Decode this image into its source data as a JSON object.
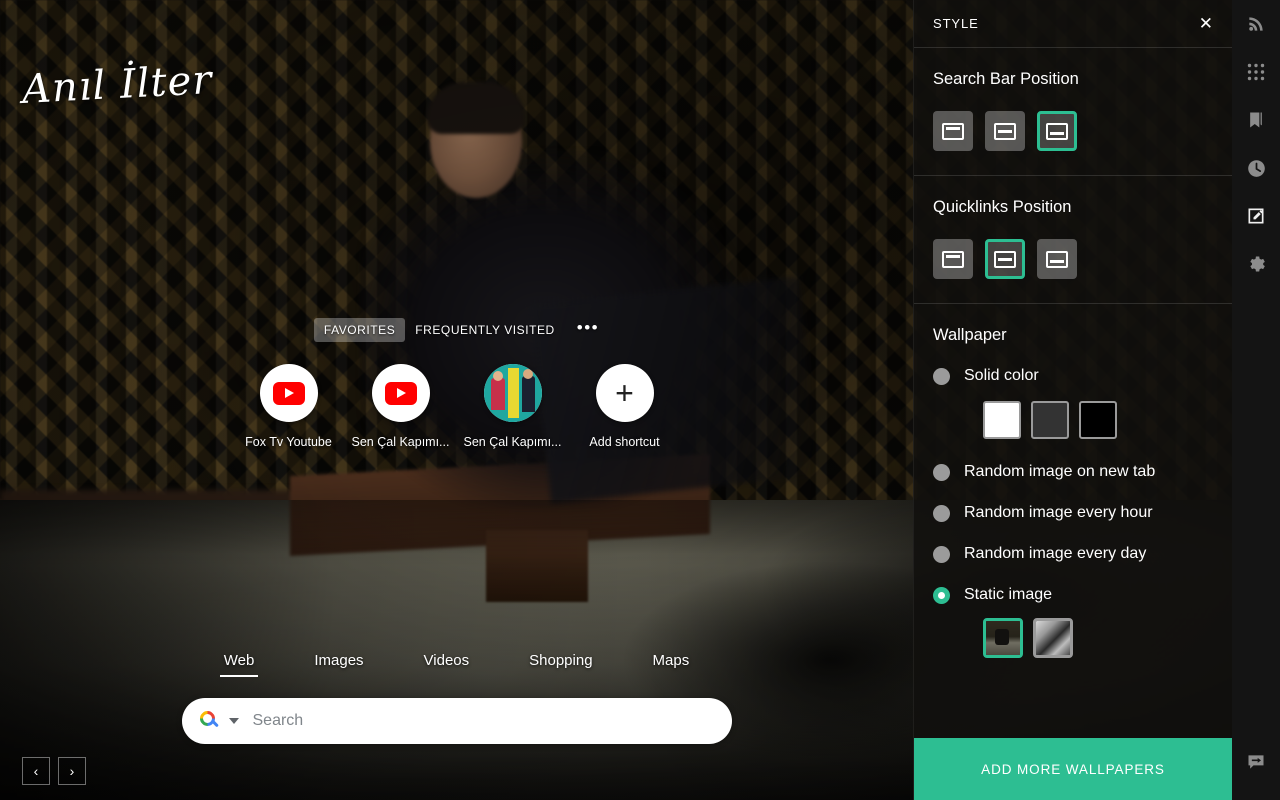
{
  "brand": {
    "signature": "Anıl İlter"
  },
  "quicklinks": {
    "tabs": [
      {
        "label": "FAVORITES",
        "active": true
      },
      {
        "label": "FREQUENTLY VISITED",
        "active": false
      }
    ],
    "more_label": "•••",
    "items": [
      {
        "label": "Fox Tv Youtube",
        "icon": "youtube-icon"
      },
      {
        "label": "Sen Çal Kapımı...",
        "icon": "youtube-icon"
      },
      {
        "label": "Sen Çal Kapımı...",
        "icon": "show-thumbnail-icon"
      },
      {
        "label": "Add shortcut",
        "icon": "plus-icon"
      }
    ]
  },
  "search": {
    "tabs": [
      {
        "label": "Web",
        "active": true
      },
      {
        "label": "Images",
        "active": false
      },
      {
        "label": "Videos",
        "active": false
      },
      {
        "label": "Shopping",
        "active": false
      },
      {
        "label": "Maps",
        "active": false
      }
    ],
    "placeholder": "Search",
    "value": "",
    "engine_icon": "google-search-icon"
  },
  "bottom_nav": {
    "prev_label": "‹",
    "next_label": "›"
  },
  "panel": {
    "title": "STYLE",
    "close_label": "✕",
    "search_bar_position": {
      "title": "Search Bar Position",
      "options": [
        {
          "name": "top",
          "selected": false
        },
        {
          "name": "middle",
          "selected": false
        },
        {
          "name": "bottom",
          "selected": true
        }
      ]
    },
    "quicklinks_position": {
      "title": "Quicklinks Position",
      "options": [
        {
          "name": "top",
          "selected": false
        },
        {
          "name": "middle",
          "selected": true
        },
        {
          "name": "bottom",
          "selected": false
        }
      ]
    },
    "wallpaper": {
      "title": "Wallpaper",
      "options": [
        {
          "label": "Solid color",
          "selected": false
        },
        {
          "label": "Random image on new tab",
          "selected": false
        },
        {
          "label": "Random image every hour",
          "selected": false
        },
        {
          "label": "Random image every day",
          "selected": false
        },
        {
          "label": "Static image",
          "selected": true
        }
      ],
      "solid_colors": [
        "#ffffff",
        "#333333",
        "#000000"
      ],
      "static_images": [
        {
          "name": "wallpaper-thumb-1",
          "selected": true
        },
        {
          "name": "wallpaper-thumb-2",
          "selected": false
        }
      ]
    },
    "add_more_label": "ADD MORE WALLPAPERS"
  },
  "rail": {
    "items": [
      {
        "icon": "rss-icon"
      },
      {
        "icon": "apps-grid-icon"
      },
      {
        "icon": "bookmark-icon"
      },
      {
        "icon": "history-clock-icon"
      },
      {
        "icon": "notes-edit-icon"
      },
      {
        "icon": "gear-icon"
      }
    ],
    "bottom": {
      "icon": "feedback-icon"
    }
  },
  "colors": {
    "accent": "#2dbe92",
    "panel_bg": "#11100e",
    "rail_bg": "#141414"
  }
}
